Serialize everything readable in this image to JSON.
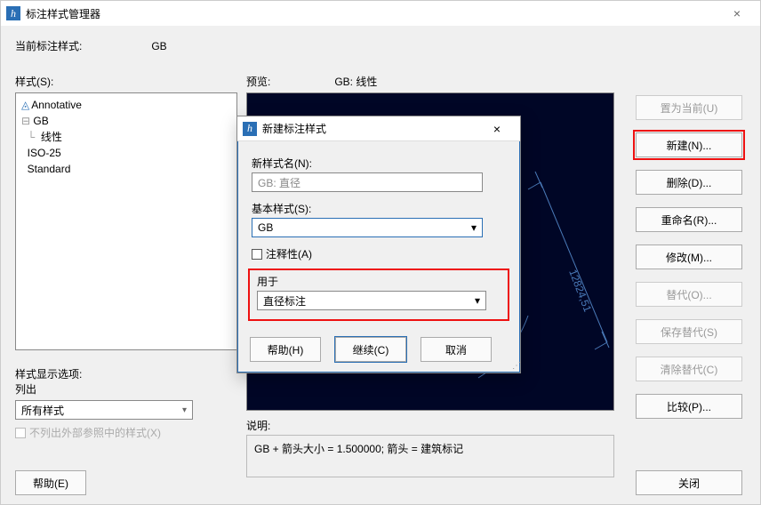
{
  "win": {
    "title": "标注样式管理器"
  },
  "current": {
    "label": "当前标注样式:",
    "value": "GB"
  },
  "stylesLabel": "样式(S):",
  "styles": {
    "i0": "Annotative",
    "i1": "GB",
    "i2": "线性",
    "i3": "ISO-25",
    "i4": "Standard"
  },
  "dispOpts": {
    "label": "样式显示选项:",
    "sub": "列出",
    "sel": "所有样式",
    "chk": "不列出外部参照中的样式(X)"
  },
  "preview": {
    "label": "预览:",
    "val": "GB: 线性",
    "dim": "12824,51"
  },
  "descr": {
    "label": "说明:",
    "text": "GB + 箭头大小  = 1.500000; 箭头 = 建筑标记"
  },
  "btns": {
    "setcur": "置为当前(U)",
    "new": "新建(N)...",
    "del": "删除(D)...",
    "ren": "重命名(R)...",
    "mod": "修改(M)...",
    "repl": "替代(O)...",
    "savesty": "保存替代(S)",
    "clear": "清除替代(C)",
    "cmp": "比较(P)..."
  },
  "help": "帮助(E)",
  "close": "关闭",
  "dlg": {
    "title": "新建标注样式",
    "nameLbl": "新样式名(N):",
    "nameVal": "GB: 直径",
    "baseLbl": "基本样式(S):",
    "baseVal": "GB",
    "anno": "注释性(A)",
    "usedLbl": "用于",
    "usedVal": "直径标注",
    "helpBtn": "帮助(H)",
    "contBtn": "继续(C)",
    "cancelBtn": "取消"
  }
}
